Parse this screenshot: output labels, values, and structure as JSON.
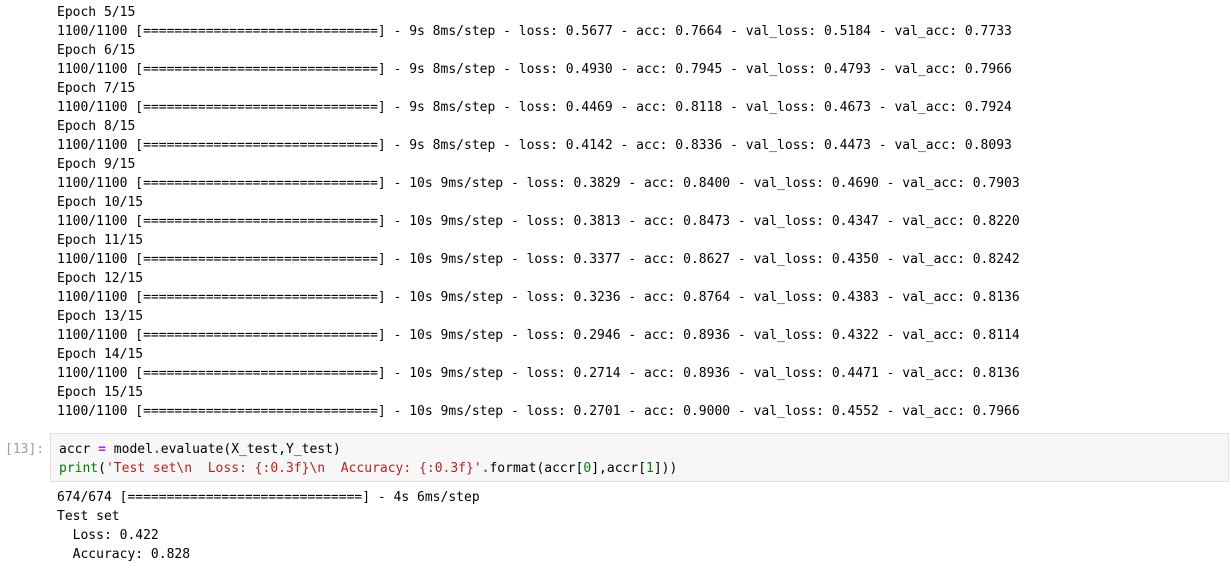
{
  "training_log": [
    "Epoch 5/15",
    "1100/1100 [==============================] - 9s 8ms/step - loss: 0.5677 - acc: 0.7664 - val_loss: 0.5184 - val_acc: 0.7733",
    "Epoch 6/15",
    "1100/1100 [==============================] - 9s 8ms/step - loss: 0.4930 - acc: 0.7945 - val_loss: 0.4793 - val_acc: 0.7966",
    "Epoch 7/15",
    "1100/1100 [==============================] - 9s 8ms/step - loss: 0.4469 - acc: 0.8118 - val_loss: 0.4673 - val_acc: 0.7924",
    "Epoch 8/15",
    "1100/1100 [==============================] - 9s 8ms/step - loss: 0.4142 - acc: 0.8336 - val_loss: 0.4473 - val_acc: 0.8093",
    "Epoch 9/15",
    "1100/1100 [==============================] - 10s 9ms/step - loss: 0.3829 - acc: 0.8400 - val_loss: 0.4690 - val_acc: 0.7903",
    "Epoch 10/15",
    "1100/1100 [==============================] - 10s 9ms/step - loss: 0.3813 - acc: 0.8473 - val_loss: 0.4347 - val_acc: 0.8220",
    "Epoch 11/15",
    "1100/1100 [==============================] - 10s 9ms/step - loss: 0.3377 - acc: 0.8627 - val_loss: 0.4350 - val_acc: 0.8242",
    "Epoch 12/15",
    "1100/1100 [==============================] - 10s 9ms/step - loss: 0.3236 - acc: 0.8764 - val_loss: 0.4383 - val_acc: 0.8136",
    "Epoch 13/15",
    "1100/1100 [==============================] - 10s 9ms/step - loss: 0.2946 - acc: 0.8936 - val_loss: 0.4322 - val_acc: 0.8114",
    "Epoch 14/15",
    "1100/1100 [==============================] - 10s 9ms/step - loss: 0.2714 - acc: 0.8936 - val_loss: 0.4471 - val_acc: 0.8136",
    "Epoch 15/15",
    "1100/1100 [==============================] - 10s 9ms/step - loss: 0.2701 - acc: 0.9000 - val_loss: 0.4552 - val_acc: 0.7966"
  ],
  "cell": {
    "prompt": "[13]:",
    "code": {
      "line1": {
        "var": "accr ",
        "eq": "=",
        "rest_a": " model",
        "dot": ".",
        "rest_b": "evaluate(X_test,Y_test)"
      },
      "line2": {
        "print": "print",
        "open": "(",
        "string": "'Test set\\n  Loss: {:0.3f}\\n  Accuracy: {:0.3f}'",
        "dot": ".",
        "format": "format(accr[",
        "idx0": "0",
        "mid": "],accr[",
        "idx1": "1",
        "close": "]))"
      }
    }
  },
  "evaluation_output": [
    "674/674 [==============================] - 4s 6ms/step",
    "Test set",
    "  Loss: 0.422",
    "  Accuracy: 0.828"
  ],
  "colors": {
    "keyword": "#008000",
    "operator": "#aa22ff",
    "string": "#ba2121",
    "prompt": "#9e9e9e",
    "cell_background": "#f7f7f7"
  }
}
